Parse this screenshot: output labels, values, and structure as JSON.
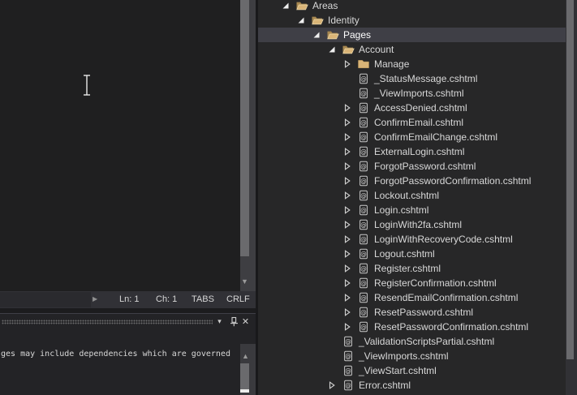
{
  "status_bar": {
    "line": "Ln: 1",
    "column": "Ch: 1",
    "tabs": "TABS",
    "line_ending": "CRLF"
  },
  "output_panel": {
    "visible_text": "ges may include dependencies which are governed"
  },
  "solution_explorer": {
    "items": [
      {
        "label": "Areas",
        "level": 0,
        "icon": "folder-open",
        "expander": "expanded",
        "selected": false
      },
      {
        "label": "Identity",
        "level": 1,
        "icon": "folder-open",
        "expander": "expanded",
        "selected": false
      },
      {
        "label": "Pages",
        "level": 2,
        "icon": "folder-open",
        "expander": "expanded",
        "selected": true
      },
      {
        "label": "Account",
        "level": 3,
        "icon": "folder-open",
        "expander": "expanded",
        "selected": false
      },
      {
        "label": "Manage",
        "level": 4,
        "icon": "folder-closed",
        "expander": "collapsed",
        "selected": false
      },
      {
        "label": "_StatusMessage.cshtml",
        "level": 4,
        "icon": "razor-file",
        "expander": "none",
        "selected": false
      },
      {
        "label": "_ViewImports.cshtml",
        "level": 4,
        "icon": "razor-file",
        "expander": "none",
        "selected": false
      },
      {
        "label": "AccessDenied.cshtml",
        "level": 4,
        "icon": "razor-file",
        "expander": "collapsed",
        "selected": false
      },
      {
        "label": "ConfirmEmail.cshtml",
        "level": 4,
        "icon": "razor-file",
        "expander": "collapsed",
        "selected": false
      },
      {
        "label": "ConfirmEmailChange.cshtml",
        "level": 4,
        "icon": "razor-file",
        "expander": "collapsed",
        "selected": false
      },
      {
        "label": "ExternalLogin.cshtml",
        "level": 4,
        "icon": "razor-file",
        "expander": "collapsed",
        "selected": false
      },
      {
        "label": "ForgotPassword.cshtml",
        "level": 4,
        "icon": "razor-file",
        "expander": "collapsed",
        "selected": false
      },
      {
        "label": "ForgotPasswordConfirmation.cshtml",
        "level": 4,
        "icon": "razor-file",
        "expander": "collapsed",
        "selected": false
      },
      {
        "label": "Lockout.cshtml",
        "level": 4,
        "icon": "razor-file",
        "expander": "collapsed",
        "selected": false
      },
      {
        "label": "Login.cshtml",
        "level": 4,
        "icon": "razor-file",
        "expander": "collapsed",
        "selected": false
      },
      {
        "label": "LoginWith2fa.cshtml",
        "level": 4,
        "icon": "razor-file",
        "expander": "collapsed",
        "selected": false
      },
      {
        "label": "LoginWithRecoveryCode.cshtml",
        "level": 4,
        "icon": "razor-file",
        "expander": "collapsed",
        "selected": false
      },
      {
        "label": "Logout.cshtml",
        "level": 4,
        "icon": "razor-file",
        "expander": "collapsed",
        "selected": false
      },
      {
        "label": "Register.cshtml",
        "level": 4,
        "icon": "razor-file",
        "expander": "collapsed",
        "selected": false
      },
      {
        "label": "RegisterConfirmation.cshtml",
        "level": 4,
        "icon": "razor-file",
        "expander": "collapsed",
        "selected": false
      },
      {
        "label": "ResendEmailConfirmation.cshtml",
        "level": 4,
        "icon": "razor-file",
        "expander": "collapsed",
        "selected": false
      },
      {
        "label": "ResetPassword.cshtml",
        "level": 4,
        "icon": "razor-file",
        "expander": "collapsed",
        "selected": false
      },
      {
        "label": "ResetPasswordConfirmation.cshtml",
        "level": 4,
        "icon": "razor-file",
        "expander": "collapsed",
        "selected": false
      },
      {
        "label": "_ValidationScriptsPartial.cshtml",
        "level": 3,
        "icon": "razor-file",
        "expander": "none",
        "selected": false
      },
      {
        "label": "_ViewImports.cshtml",
        "level": 3,
        "icon": "razor-file",
        "expander": "none",
        "selected": false
      },
      {
        "label": "_ViewStart.cshtml",
        "level": 3,
        "icon": "razor-file",
        "expander": "none",
        "selected": false
      },
      {
        "label": "Error.cshtml",
        "level": 3,
        "icon": "razor-file",
        "expander": "collapsed",
        "selected": false
      }
    ]
  },
  "icons": {
    "scroll_down": "▼",
    "scroll_up": "▲",
    "scroll_right": "▶",
    "window_position_chevron": "▾",
    "close": "✕"
  },
  "colors": {
    "selection_background": "#3F3F46",
    "folder_icon": "#DCB67A",
    "tree_background": "#272728",
    "editor_background": "#1F1F20",
    "status_bar_background": "#313136"
  }
}
